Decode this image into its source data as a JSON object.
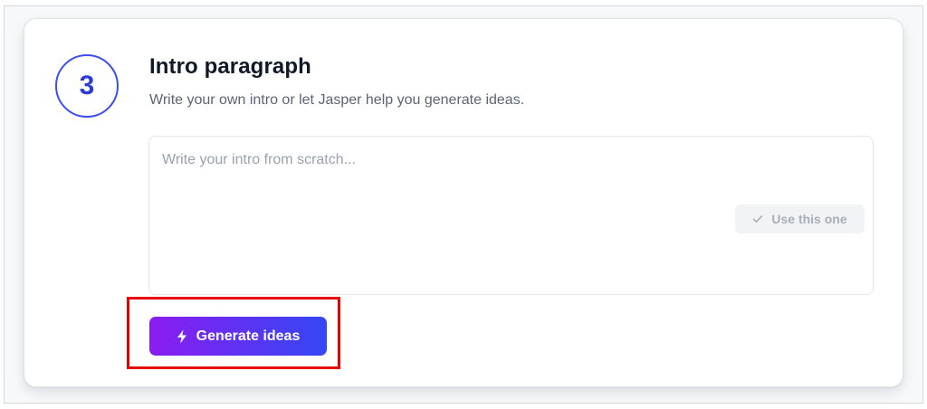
{
  "step": {
    "number": "3",
    "title": "Intro paragraph",
    "subtitle": "Write your own intro or let Jasper help you generate ideas."
  },
  "editor": {
    "placeholder": "Write your intro from scratch...",
    "value": ""
  },
  "use_button": {
    "label": "Use this one",
    "icon": "check-icon"
  },
  "generate_button": {
    "label": "Generate ideas",
    "icon": "lightning-bolt-icon"
  },
  "colors": {
    "accent": "#3b4ef0",
    "gradient_start": "#8b1cf0",
    "gradient_end": "#3547f5",
    "highlight": "#e60000"
  }
}
